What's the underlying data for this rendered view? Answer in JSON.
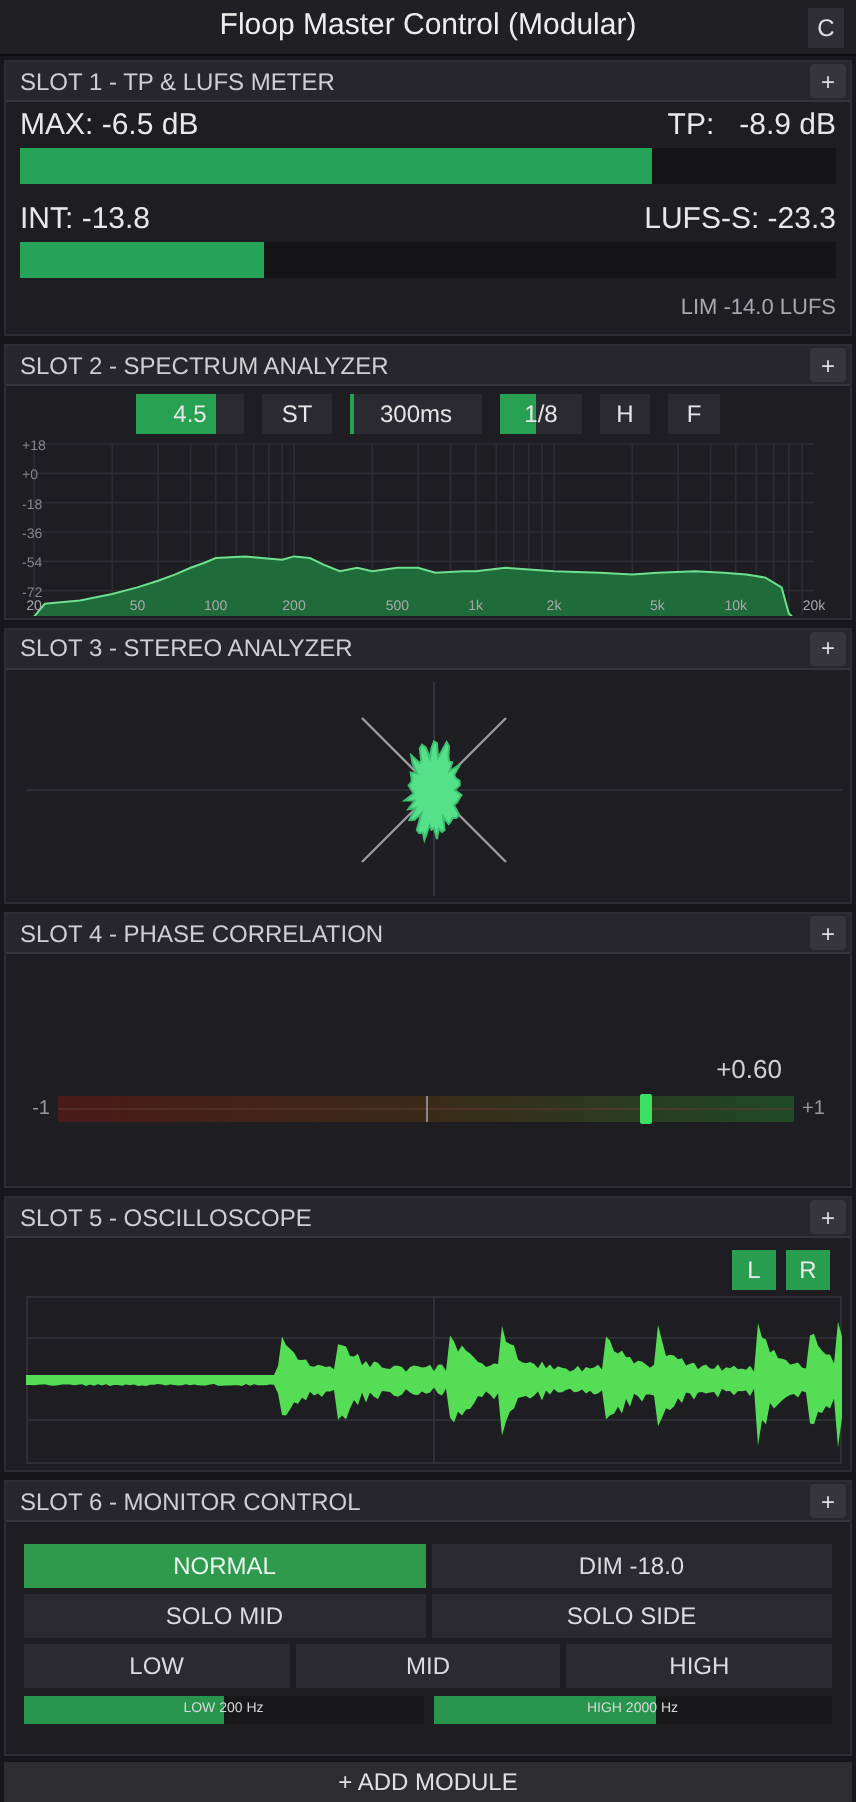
{
  "window": {
    "title": "Floop Master Control (Modular)",
    "corner_button": "C"
  },
  "slots": [
    {
      "kind": "meter",
      "title": "SLOT 1 - TP & LUFS METER",
      "add_button": "+",
      "meters": [
        {
          "left_label": "MAX: -6.5 dB",
          "right_label": "TP:   -8.9 dB",
          "level": 0.775
        },
        {
          "left_label": "INT: -13.8",
          "right_label": "LUFS-S: -23.3",
          "level": 0.3
        }
      ],
      "footer": "LIM -14.0 LUFS"
    },
    {
      "kind": "spectrum",
      "title": "SLOT 2 - SPECTRUM ANALYZER",
      "add_button": "+",
      "controls": [
        {
          "kind": "slider",
          "label": "4.5",
          "level": 0.74
        },
        {
          "kind": "button",
          "label": "ST"
        },
        {
          "kind": "slider",
          "label": "300ms",
          "level": 0.03
        },
        {
          "kind": "slider",
          "label": "1/8",
          "level": 0.45
        },
        {
          "kind": "button",
          "label": "H"
        },
        {
          "kind": "button",
          "label": "F"
        }
      ],
      "y_labels": [
        "+18",
        "+0",
        "-18",
        "-36",
        "-54",
        "-72"
      ],
      "x_labels": [
        "20",
        "50",
        "100",
        "200",
        "500",
        "1k",
        "2k",
        "5k",
        "10k",
        "20k"
      ]
    },
    {
      "kind": "stereo",
      "title": "SLOT 3 - STEREO ANALYZER",
      "add_button": "+"
    },
    {
      "kind": "phase",
      "title": "SLOT 4 - PHASE CORRELATION",
      "add_button": "+",
      "reading": "+0.60",
      "min_label": "-1",
      "max_label": "+1",
      "level": 0.8
    },
    {
      "kind": "scope",
      "title": "SLOT 5 - OSCILLOSCOPE",
      "add_button": "+",
      "channels": [
        {
          "label": "L",
          "on": true
        },
        {
          "label": "R",
          "on": true
        }
      ]
    },
    {
      "kind": "monitor",
      "title": "SLOT 6 - MONITOR CONTROL",
      "add_button": "+",
      "rows": [
        [
          {
            "label": "NORMAL",
            "selected": true
          },
          {
            "label": "DIM -18.0",
            "selected": false
          }
        ],
        [
          {
            "label": "SOLO MID",
            "selected": false
          },
          {
            "label": "SOLO SIDE",
            "selected": false
          }
        ],
        [
          {
            "label": "LOW",
            "selected": false
          },
          {
            "label": "MID",
            "selected": false
          },
          {
            "label": "HIGH",
            "selected": false
          }
        ]
      ],
      "crossovers": [
        {
          "label": "LOW 200 Hz",
          "level": 0.5
        },
        {
          "label": "HIGH 2000 Hz",
          "level": 0.56
        }
      ]
    }
  ],
  "add_module": "+ ADD MODULE"
}
